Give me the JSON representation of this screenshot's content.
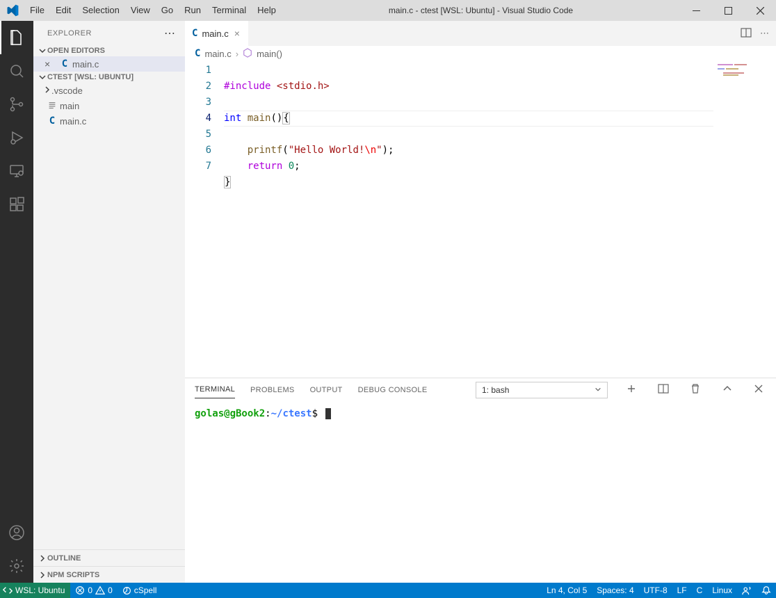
{
  "window": {
    "title": "main.c - ctest [WSL: Ubuntu] - Visual Studio Code"
  },
  "menu": {
    "file": "File",
    "edit": "Edit",
    "selection": "Selection",
    "view": "View",
    "go": "Go",
    "run": "Run",
    "terminal": "Terminal",
    "help": "Help"
  },
  "sidebar": {
    "title": "EXPLORER",
    "open_editors": "OPEN EDITORS",
    "workspace": "CTEST [WSL: UBUNTU]",
    "editors": [
      {
        "name": "main.c"
      }
    ],
    "files": {
      "vscode": ".vscode",
      "main_bin": "main",
      "main_c": "main.c"
    },
    "outline": "OUTLINE",
    "npm": "NPM SCRIPTS"
  },
  "tab": {
    "label": "main.c"
  },
  "breadcrumb": {
    "file": "main.c",
    "symbol": "main()"
  },
  "code": {
    "lines": [
      "1",
      "2",
      "3",
      "4",
      "5",
      "6",
      "7"
    ],
    "include_kw": "#include",
    "include_hdr": "<stdio.h>",
    "int_kw": "int",
    "main_fn": "main",
    "parens": "()",
    "lbrace": "{",
    "printf": "printf",
    "lparen": "(",
    "str1": "\"Hello World!",
    "esc": "\\n",
    "str2": "\"",
    "rparen_semi": ");",
    "return_kw": "return",
    "zero": "0",
    "semi": ";",
    "rbrace": "}"
  },
  "panel": {
    "tabs": {
      "terminal": "TERMINAL",
      "problems": "PROBLEMS",
      "output": "OUTPUT",
      "debug": "DEBUG CONSOLE"
    },
    "term_select": "1: bash",
    "prompt": {
      "userhost": "golas@gBook2",
      "path": "~/ctest",
      "suffix": "$"
    }
  },
  "status": {
    "remote": "WSL: Ubuntu",
    "errors": "0",
    "warnings": "0",
    "cspell": "cSpell",
    "lncol": "Ln 4, Col 5",
    "spaces": "Spaces: 4",
    "encoding": "UTF-8",
    "eol": "LF",
    "lang": "C",
    "os": "Linux"
  }
}
